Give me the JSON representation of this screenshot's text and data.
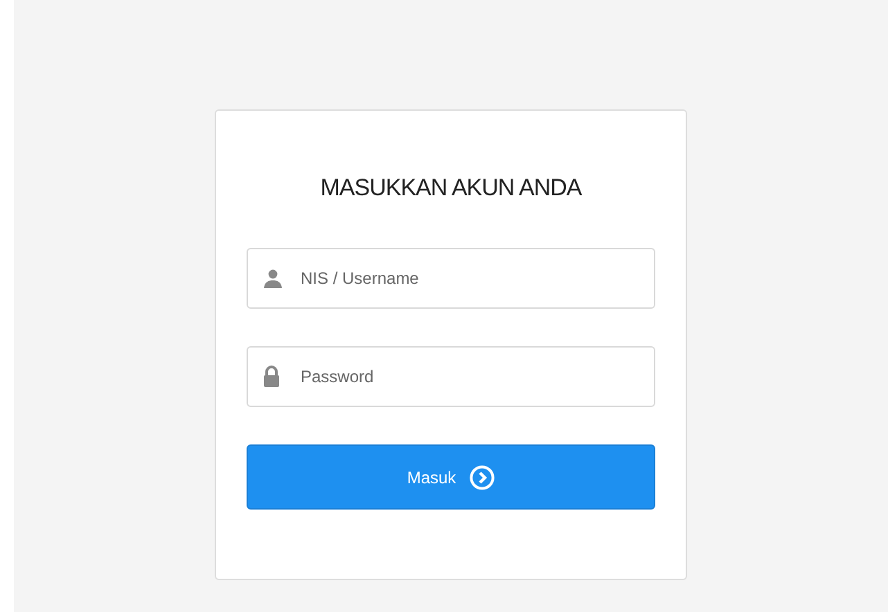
{
  "login": {
    "title": "MASUKKAN AKUN ANDA",
    "fields": [
      {
        "kind": "user",
        "placeholder": "NIS / Username"
      },
      {
        "kind": "lock",
        "placeholder": "Password"
      }
    ],
    "submit": "Masuk"
  }
}
